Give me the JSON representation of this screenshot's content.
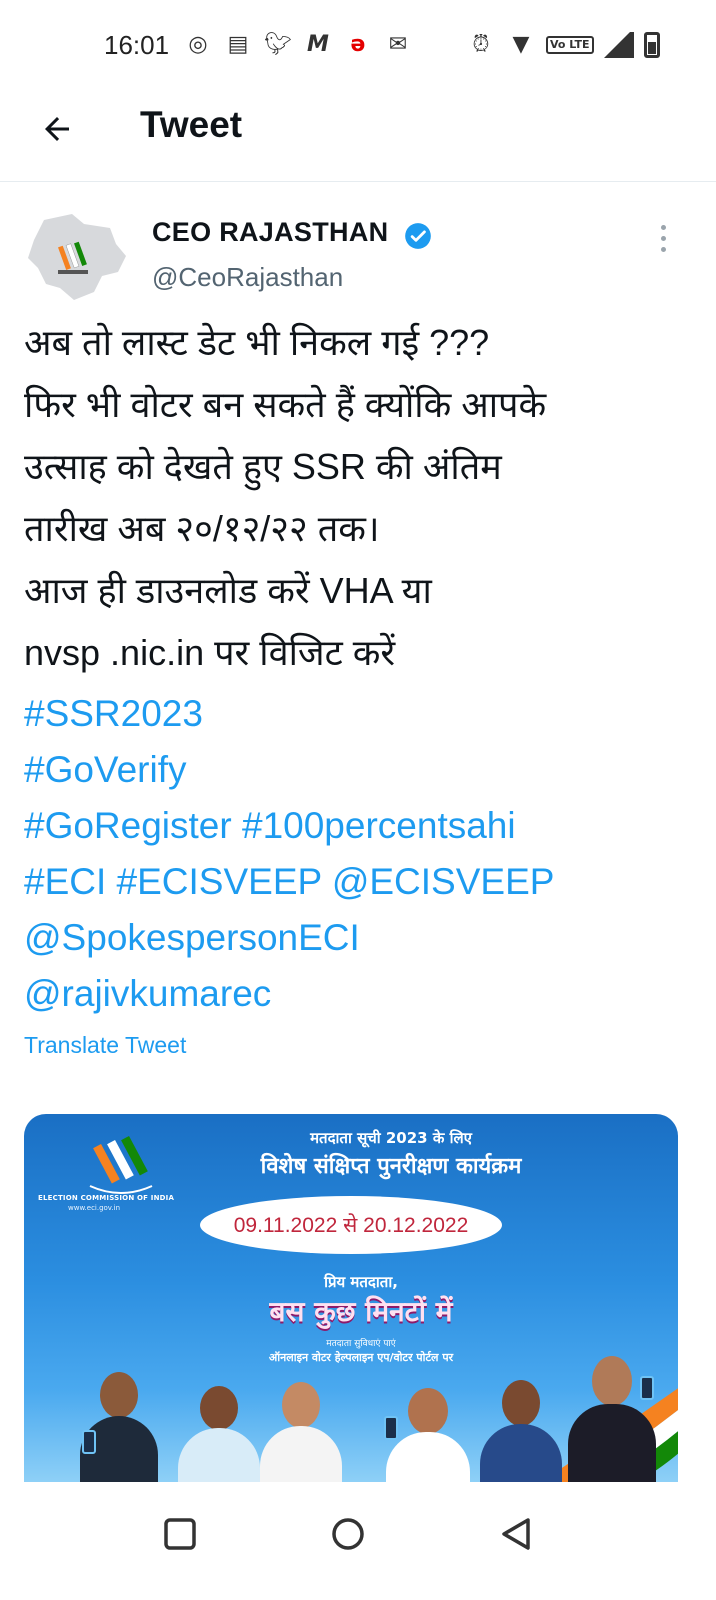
{
  "status_bar": {
    "time": "16:01",
    "notification_icons": [
      "whatsapp-icon",
      "news-icon",
      "twitter-icon",
      "m-icon",
      "airtel-icon",
      "gmail-icon"
    ],
    "system_icons": [
      "alarm-icon",
      "wifi-icon",
      "volte-icon",
      "signal-icon",
      "battery-icon"
    ],
    "volte_label": "Vo LTE"
  },
  "header": {
    "title": "Tweet",
    "back_icon": "arrow-left-icon"
  },
  "tweet": {
    "author_name": "CEO RAJASTHAN",
    "author_handle": "@CeoRajasthan",
    "verified": true,
    "body_lines": [
      "अब तो लास्ट डेट भी निकल गई ???",
      "फिर भी वोटर बन सकते हैं क्योंकि आपके",
      "उत्साह को देखते हुए SSR की अंतिम",
      "तारीख अब २०/१२/२२ तक।",
      "आज ही डाउनलोड करें VHA या",
      "nvsp .nic.in पर विजिट करें"
    ],
    "tags": {
      "line1": "#SSR2023",
      "line2": "#GoVerify",
      "line3a": "#GoRegister",
      "line3b": "#100percentsahi",
      "line4a": "#ECI",
      "line4b": "#ECISVEEP",
      "line4c": "@ECISVEEP",
      "line5": "@SpokespersonECI",
      "line6": "@rajivkumarec"
    },
    "translate_label": "Translate Tweet"
  },
  "media": {
    "eci_caption": "ELECTION COMMISSION OF INDIA",
    "eci_url": "www.eci.gov.in",
    "line1": "मतदाता सूची 2023 के लिए",
    "line2": "विशेष संक्षिप्त पुनरीक्षण कार्यक्रम",
    "dates": "09.11.2022 से 20.12.2022",
    "line3": "प्रिय मतदाता,",
    "line4": "बस कुछ मिनटों में",
    "line5": "मतदाता सुविधाएं पाएं",
    "line6": "ऑनलाइन वोटर हेल्पलाइन एप/वोटर पोर्टल पर"
  },
  "colors": {
    "link": "#1d9bf0",
    "text": "#0f1419",
    "handle": "#536471",
    "media_bg": "#2b8ee0"
  }
}
